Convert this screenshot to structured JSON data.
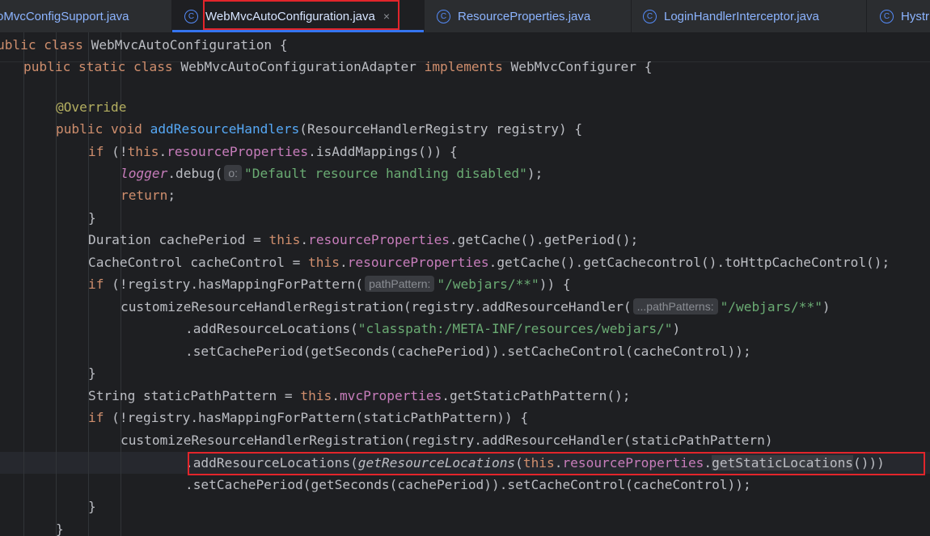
{
  "tabs": [
    {
      "label": "oMvcConfigSupport.java",
      "has_icon": false,
      "active": false
    },
    {
      "label": "WebMvcAutoConfiguration.java",
      "has_icon": true,
      "active": true,
      "close": "×"
    },
    {
      "label": "ResourceProperties.java",
      "has_icon": true,
      "active": false
    },
    {
      "label": "LoginHandlerInterceptor.java",
      "has_icon": true,
      "active": false
    },
    {
      "label": "Hystr",
      "has_icon": true,
      "active": false
    }
  ],
  "tab_icon_letter": "C",
  "code": {
    "l1": {
      "kw1": "ublic class ",
      "name": "WebMvcAutoConfiguration",
      "rest": " {"
    },
    "l2": {
      "kw1": "public static class ",
      "name": "WebMvcAutoConfigurationAdapter",
      "kw2": " implements ",
      "iface": "WebMvcConfigurer",
      "rest": " {"
    },
    "l3": {
      "ann": "@Override"
    },
    "l4": {
      "kw": "public void ",
      "fn": "addResourceHandlers",
      "rest": "(ResourceHandlerRegistry registry) {"
    },
    "l5": {
      "kw1": "if",
      "a": " (!",
      "kw2": "this",
      "dot": ".",
      "fld": "resourceProperties",
      "rest": ".isAddMappings()) {"
    },
    "l6": {
      "logger": "logger",
      "a": ".debug(",
      "hint": "o:",
      "str": "\"Default resource handling disabled\"",
      "rest": ");"
    },
    "l7": {
      "kw": "return",
      "rest": ";"
    },
    "l8": {
      "text": "}"
    },
    "l9": {
      "a": "Duration cachePeriod = ",
      "kw": "this",
      "dot": ".",
      "fld": "resourceProperties",
      "rest": ".getCache().getPeriod();"
    },
    "l10": {
      "a": "CacheControl cacheControl = ",
      "kw": "this",
      "dot": ".",
      "fld": "resourceProperties",
      "rest": ".getCache().getCachecontrol().toHttpCacheControl();"
    },
    "l11": {
      "kw": "if",
      "a": " (!registry.hasMappingForPattern(",
      "hint": "pathPattern:",
      "str": "\"/webjars/**\"",
      "rest": ")) {"
    },
    "l12": {
      "a": "customizeResourceHandlerRegistration(registry.addResourceHandler(",
      "hint": "...pathPatterns:",
      "str": "\"/webjars/**\"",
      "rest": ")"
    },
    "l13": {
      "a": ".addResourceLocations(",
      "str": "\"classpath:/META-INF/resources/webjars/\"",
      "rest": ")"
    },
    "l14": {
      "text": ".setCachePeriod(getSeconds(cachePeriod)).setCacheControl(cacheControl));"
    },
    "l15": {
      "text": "}"
    },
    "l16": {
      "a": "String staticPathPattern = ",
      "kw": "this",
      "dot": ".",
      "fld": "mvcProperties",
      "rest": ".getStaticPathPattern();"
    },
    "l17": {
      "kw": "if",
      "rest": " (!registry.hasMappingForPattern(staticPathPattern)) {"
    },
    "l18": {
      "text": "customizeResourceHandlerRegistration(registry.addResourceHandler(staticPathPattern)"
    },
    "l19": {
      "a": ".addResourceLocations(",
      "ital": "getResourceLocations",
      "b": "(",
      "kw": "this",
      "dot": ".",
      "fld": "resourceProperties",
      "c": ".",
      "sel": "getStaticLocations",
      "rest": "()))"
    },
    "l20": {
      "text": ".setCachePeriod(getSeconds(cachePeriod)).setCacheControl(cacheControl));"
    },
    "l21": {
      "text": "}"
    },
    "l22": {
      "text": "}"
    }
  },
  "colors": {
    "keyword": "#cf8e6d",
    "function": "#56a8f5",
    "string": "#6aab73",
    "annotation": "#b3ae60",
    "field": "#c77dbb",
    "text": "#bcbec4",
    "highlight_box": "#e2252b",
    "accent": "#3574f0"
  }
}
